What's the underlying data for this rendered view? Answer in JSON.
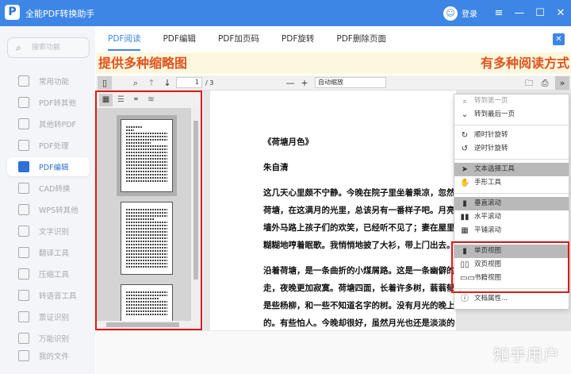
{
  "app": {
    "title": "全能PDF转换助手",
    "login": "登录"
  },
  "sidebar": {
    "search_placeholder": "搜索功能",
    "items": [
      {
        "label": "常用功能",
        "icon": "star-doc-icon"
      },
      {
        "label": "PDF转其他",
        "icon": "pdf-convert-icon"
      },
      {
        "label": "其他转PDF",
        "icon": "to-pdf-icon"
      },
      {
        "label": "PDF处理",
        "icon": "pdf-process-icon"
      },
      {
        "label": "PDF编辑",
        "icon": "pdf-edit-icon",
        "active": true
      },
      {
        "label": "CAD转换",
        "icon": "cad-icon"
      },
      {
        "label": "WPS转其他",
        "icon": "wps-icon"
      },
      {
        "label": "文字识别",
        "icon": "ocr-icon"
      },
      {
        "label": "翻译工具",
        "icon": "translate-icon"
      },
      {
        "label": "压缩工具",
        "icon": "compress-icon"
      },
      {
        "label": "转语音工具",
        "icon": "voice-icon"
      },
      {
        "label": "票证识别",
        "icon": "ticket-icon"
      },
      {
        "label": "万能识别",
        "icon": "universal-icon"
      }
    ],
    "my_files": "我的文件"
  },
  "tabs": [
    "PDF阅读",
    "PDF编辑",
    "PDF加页码",
    "PDF旋转",
    "PDF删除页面"
  ],
  "banner": {
    "left": "提供多种缩略图",
    "right": "有多种阅读方式"
  },
  "toolbar": {
    "page": "1",
    "page_total": "/ 3",
    "zoom": "自动缩放"
  },
  "document": {
    "title": "《荷塘月色》",
    "author": "朱自清",
    "lines": [
      "这几天心里颇不宁静。今晚在院子里坐着乘凉，忽然想",
      "荷塘，在这满月的光里，总该另有一番样子吧。月亮渐",
      "墙外马路上孩子们的欢笑，已经听不见了；妻在屋里拍",
      "糊糊地哼着眠歌。我悄悄地披了大衫，带上门出去。",
      "沿着荷塘，是一条曲折的小煤屑路。这是一条幽僻的",
      "走，夜晚更加寂寞。荷塘四面，长着许多树，蓊蓊郁郁",
      "是些杨柳，和一些不知道名字的树。没有月光的晚上，",
      "的。有些怕人。今晚却很好，虽然月光也还是淡淡的"
    ]
  },
  "menu": {
    "groups": [
      [
        {
          "label": "转到第一页",
          "icon": "first-page-icon",
          "disabled": true
        },
        {
          "label": "转到最后一页",
          "icon": "last-page-icon"
        }
      ],
      [
        {
          "label": "顺时针旋转",
          "icon": "rotate-cw-icon"
        },
        {
          "label": "逆时针旋转",
          "icon": "rotate-ccw-icon"
        }
      ],
      [
        {
          "label": "文本选择工具",
          "icon": "cursor-icon",
          "selected": true
        },
        {
          "label": "手形工具",
          "icon": "hand-icon"
        }
      ],
      [
        {
          "label": "垂直滚动",
          "icon": "vertical-scroll-icon",
          "selected": true
        },
        {
          "label": "水平滚动",
          "icon": "horizontal-scroll-icon"
        },
        {
          "label": "平铺滚动",
          "icon": "wrapped-scroll-icon"
        }
      ],
      [
        {
          "label": "单页视图",
          "icon": "single-page-icon",
          "selected": true
        },
        {
          "label": "双页视图",
          "icon": "double-page-icon"
        },
        {
          "label": "书籍视图",
          "icon": "book-view-icon"
        }
      ],
      [
        {
          "label": "文档属性...",
          "icon": "info-icon"
        }
      ]
    ]
  },
  "watermark": "知乎用户"
}
